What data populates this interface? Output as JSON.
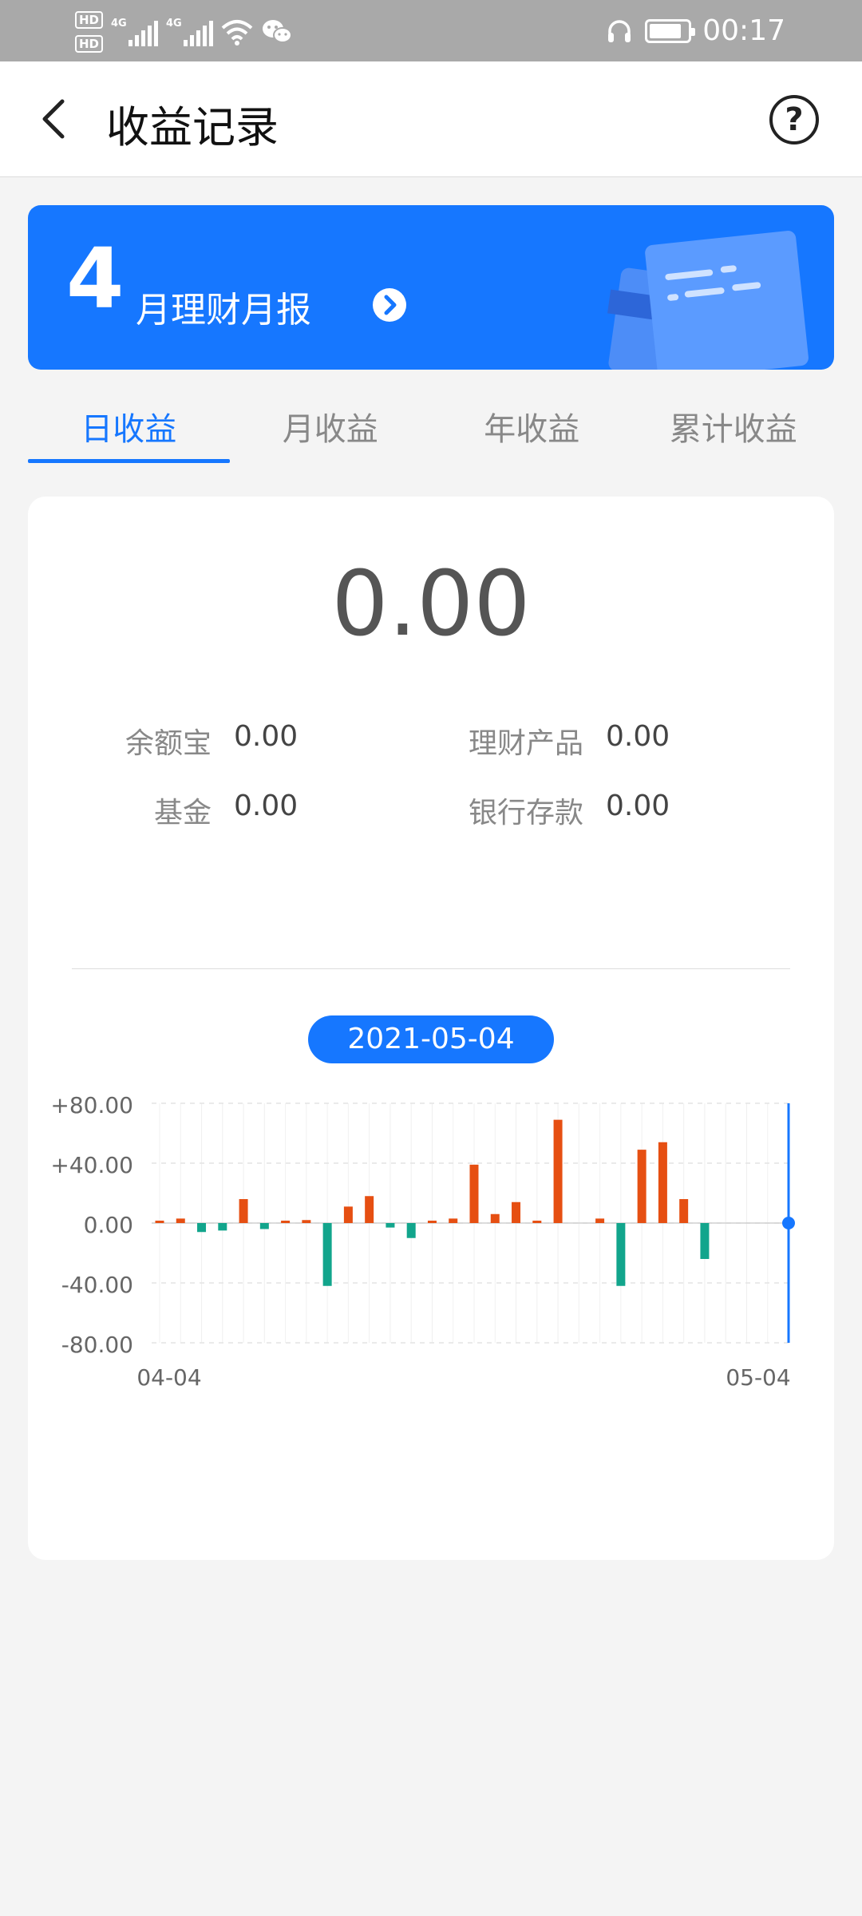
{
  "status_bar": {
    "hd1": "HD",
    "hd2": "HD",
    "net1": "4G",
    "net2": "4G",
    "time": "00:17",
    "battery_level": 0.85,
    "icons": [
      "signal-icon",
      "wifi-icon",
      "wechat-icon",
      "headphones-icon",
      "battery-icon"
    ]
  },
  "nav": {
    "title": "收益记录",
    "back_icon": "chevron-left-icon",
    "help_label": "?"
  },
  "banner": {
    "month_number": "4",
    "text": "月理财月报",
    "arrow_icon": "chevron-right-circle-icon"
  },
  "tabs": [
    {
      "label": "日收益",
      "active": true
    },
    {
      "label": "月收益",
      "active": false
    },
    {
      "label": "年收益",
      "active": false
    },
    {
      "label": "累计收益",
      "active": false
    }
  ],
  "summary": {
    "total": "0.00",
    "items": [
      {
        "label": "余额宝",
        "value": "0.00"
      },
      {
        "label": "理财产品",
        "value": "0.00"
      },
      {
        "label": "基金",
        "value": "0.00"
      },
      {
        "label": "银行存款",
        "value": "0.00"
      }
    ]
  },
  "selected_date": "2021-05-04",
  "colors": {
    "accent": "#1677ff",
    "positive": "#e64f12",
    "negative": "#12a58c"
  },
  "chart_data": {
    "type": "bar",
    "ylim": [
      -80,
      80
    ],
    "y_ticks": [
      "+80.00",
      "+40.00",
      "0.00",
      "-40.00",
      "-80.00"
    ],
    "y_tick_values": [
      80,
      40,
      0,
      -40,
      -80
    ],
    "x_tick_labels": [
      "04-04",
      "05-04"
    ],
    "categories": [
      "04-04",
      "04-05",
      "04-06",
      "04-07",
      "04-08",
      "04-09",
      "04-10",
      "04-11",
      "04-12",
      "04-13",
      "04-14",
      "04-15",
      "04-16",
      "04-17",
      "04-18",
      "04-19",
      "04-20",
      "04-21",
      "04-22",
      "04-23",
      "04-24",
      "04-25",
      "04-26",
      "04-27",
      "04-28",
      "04-29",
      "04-30",
      "05-01",
      "05-02",
      "05-03",
      "05-04"
    ],
    "values": [
      1,
      3,
      -6,
      -5,
      16,
      -4,
      1,
      2,
      -42,
      11,
      18,
      -3,
      -10,
      0.5,
      3,
      39,
      6,
      14,
      1,
      69,
      0,
      3,
      -42,
      49,
      54,
      16,
      -24,
      0,
      0,
      0,
      0
    ],
    "selected_index": 30,
    "grid": true
  }
}
